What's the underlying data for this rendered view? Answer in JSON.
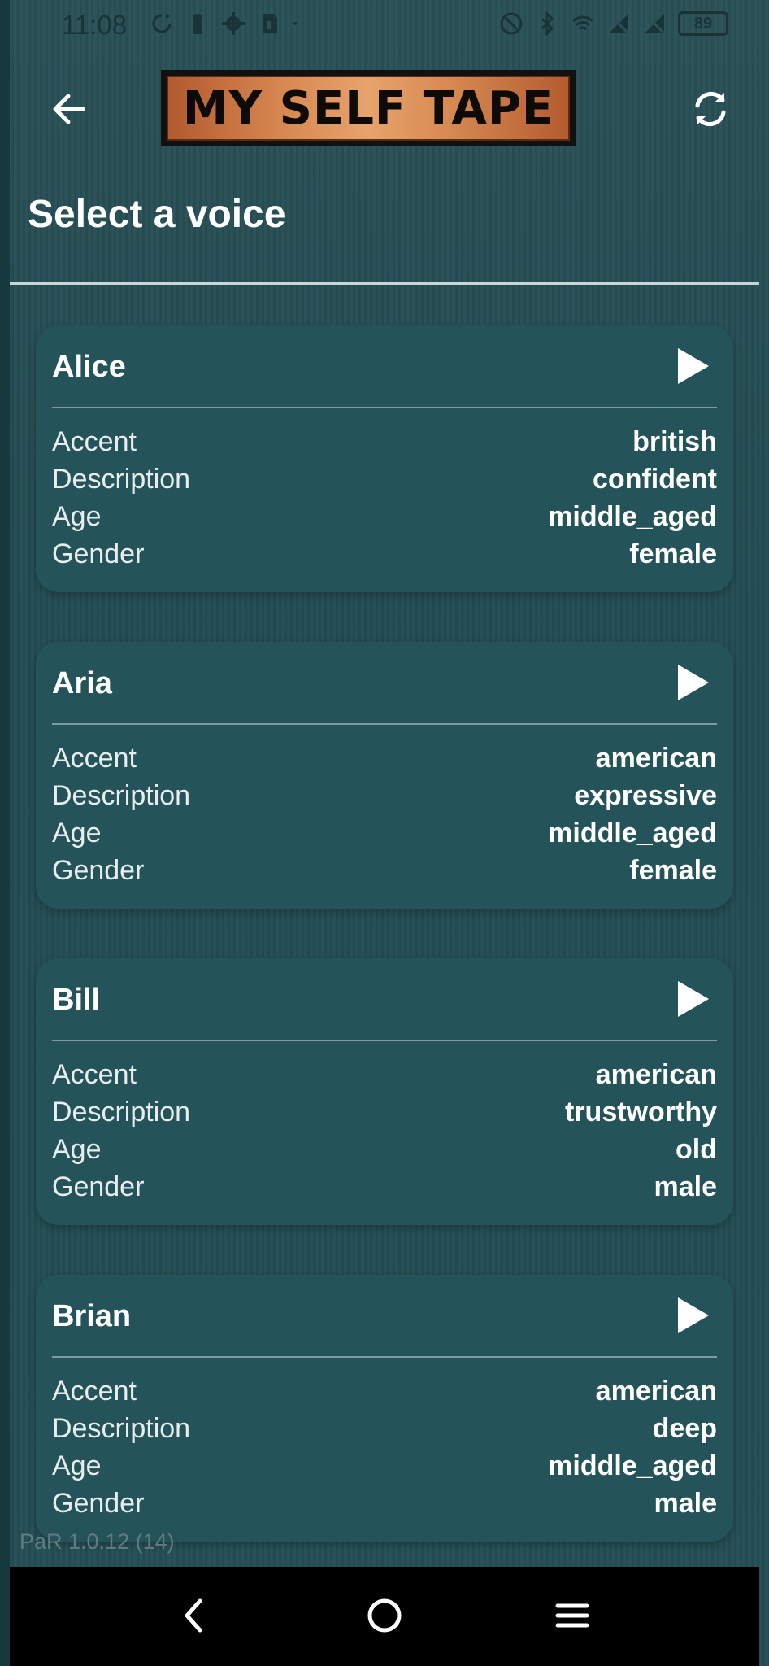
{
  "status_bar": {
    "time": "11:08",
    "battery": "89",
    "icons_left": [
      "sync-icon",
      "lock-icon",
      "gear-icon",
      "sd-card-icon",
      "dot-icon"
    ],
    "icons_right": [
      "nfc-icon",
      "bluetooth-icon",
      "wifi-icon",
      "no-signal-icon",
      "no-signal-icon",
      "battery-icon"
    ]
  },
  "app_bar": {
    "logo_text": "MY SELF TAPE",
    "back_icon": "arrow-left-icon",
    "refresh_icon": "refresh-icon"
  },
  "page_title": "Select a voice",
  "field_labels": {
    "accent": "Accent",
    "description": "Description",
    "age": "Age",
    "gender": "Gender"
  },
  "voices": [
    {
      "name": "Alice",
      "accent": "british",
      "description": "confident",
      "age": "middle_aged",
      "gender": "female"
    },
    {
      "name": "Aria",
      "accent": "american",
      "description": "expressive",
      "age": "middle_aged",
      "gender": "female"
    },
    {
      "name": "Bill",
      "accent": "american",
      "description": "trustworthy",
      "age": "old",
      "gender": "male"
    },
    {
      "name": "Brian",
      "accent": "american",
      "description": "deep",
      "age": "middle_aged",
      "gender": "male"
    }
  ],
  "version": "PaR 1.0.12 (14)",
  "nav_bar": {
    "icons": [
      "back-icon",
      "home-icon",
      "menu-icon"
    ]
  },
  "colors": {
    "background": "#1f4a50",
    "card": "#24535a",
    "text": "#ffffff"
  }
}
